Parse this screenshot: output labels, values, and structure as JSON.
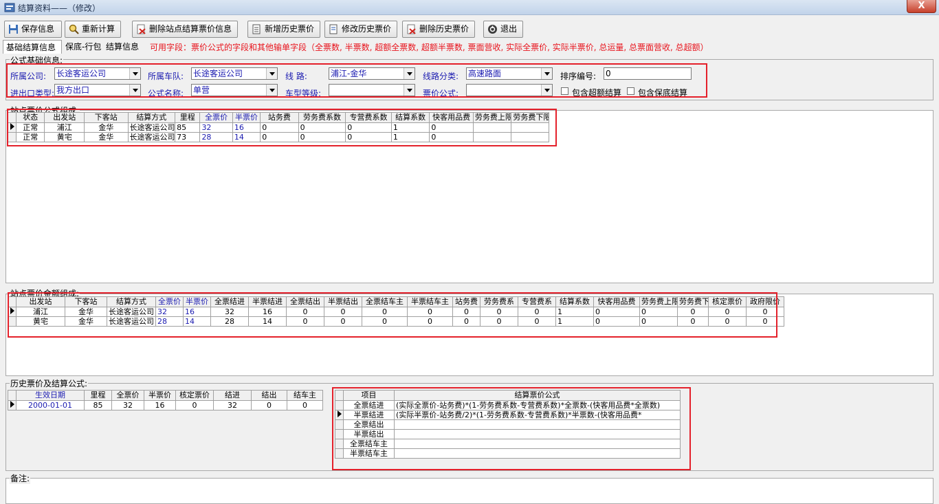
{
  "window": {
    "title": "结算资料——（修改）",
    "close_label": "X"
  },
  "toolbar": {
    "save": "保存信息",
    "recalc": "重新计算",
    "delete_station": "删除站点结算票价信息",
    "add_history": "新增历史票价",
    "edit_history": "修改历史票价",
    "delete_history": "删除历史票价",
    "exit": "退出"
  },
  "tabs": [
    "基础结算信息",
    "保底-行包",
    "结算信息"
  ],
  "fields_hint": "可用字段：票价公式的字段和其他输单字段（全票数, 半票数, 超额全票数, 超额半票数, 票面营收, 实际全票价, 实际半票价, 总运量, 总票面营收, 总超额）",
  "basic": {
    "group_label": "公式基础信息:",
    "company_label": "所属公司:",
    "company": "长途客运公司",
    "fleet_label": "所属车队:",
    "fleet": "长途客运公司",
    "route_label": "线    路:",
    "route": "浦江-金华",
    "route_type_label": "线路分类:",
    "route_type": "高速路面",
    "sort_label": "排序编号:",
    "sort": "0",
    "io_type_label": "进出口类型:",
    "io_type": "我方出口",
    "formula_name_label": "公式名称:",
    "formula_name": "单营",
    "vehicle_grade_label": "车型等级:",
    "vehicle_grade": "",
    "fare_formula_label": "票价公式:",
    "fare_formula": "",
    "chk_overload": "包含超额结算",
    "chk_guarantee": "包含保底结算"
  },
  "station_formula": {
    "group_label": "站点票价公式组成:",
    "headers": [
      "状态",
      "出发站",
      "下客站",
      "结算方式",
      "里程",
      "全票价",
      "半票价",
      "站务费",
      "劳务费系数",
      "专营费系数",
      "结算系数",
      "快客用品费",
      "劳务费上限",
      "劳务费下限"
    ],
    "rows": [
      [
        "正常",
        "浦江",
        "金华",
        "长途客运公司",
        "85",
        "32",
        "16",
        "0",
        "0",
        "0",
        "1",
        "0",
        "",
        ""
      ],
      [
        "正常",
        "黄宅",
        "金华",
        "长途客运公司",
        "73",
        "28",
        "14",
        "0",
        "0",
        "0",
        "1",
        "0",
        "",
        ""
      ]
    ]
  },
  "station_amount": {
    "group_label": "站点票价金额组成:",
    "headers": [
      "出发站",
      "下客站",
      "结算方式",
      "全票价",
      "半票价",
      "全票结进",
      "半票结进",
      "全票结出",
      "半票结出",
      "全票结车主",
      "半票结车主",
      "站务费",
      "劳务费系",
      "专营费系",
      "结算系数",
      "快客用品费",
      "劳务费上限",
      "劳务费下",
      "核定票价",
      "政府限价"
    ],
    "rows": [
      [
        "浦江",
        "金华",
        "长途客运公司",
        "32",
        "16",
        "32",
        "16",
        "0",
        "0",
        "0",
        "0",
        "0",
        "0",
        "0",
        "1",
        "0",
        "0",
        "0",
        "0",
        "0"
      ],
      [
        "黄宅",
        "金华",
        "长途客运公司",
        "28",
        "14",
        "28",
        "14",
        "0",
        "0",
        "0",
        "0",
        "0",
        "0",
        "0",
        "1",
        "0",
        "0",
        "0",
        "0",
        "0"
      ]
    ]
  },
  "history": {
    "group_label": "历史票价及结算公式:",
    "headers": [
      "生效日期",
      "里程",
      "全票价",
      "半票价",
      "核定票价",
      "结进",
      "结出",
      "结车主"
    ],
    "rows": [
      [
        "2000-01-01",
        "85",
        "32",
        "16",
        "0",
        "32",
        "0",
        "0"
      ]
    ]
  },
  "formulas": {
    "headers": [
      "项目",
      "结算票价公式"
    ],
    "rows": [
      [
        "全票结进",
        "(实际全票价-站务费)*(1-劳务费系数-专营费系数)*全票数-(快客用品费*全票数)"
      ],
      [
        "半票结进",
        "(实际半票价-站务费/2)*(1-劳务费系数-专营费系数)*半票数-(快客用品费*"
      ],
      [
        "全票结出",
        ""
      ],
      [
        "半票结出",
        ""
      ],
      [
        "全票结车主",
        ""
      ],
      [
        "半票结车主",
        ""
      ]
    ]
  },
  "remarks": {
    "group_label": "备注:"
  }
}
